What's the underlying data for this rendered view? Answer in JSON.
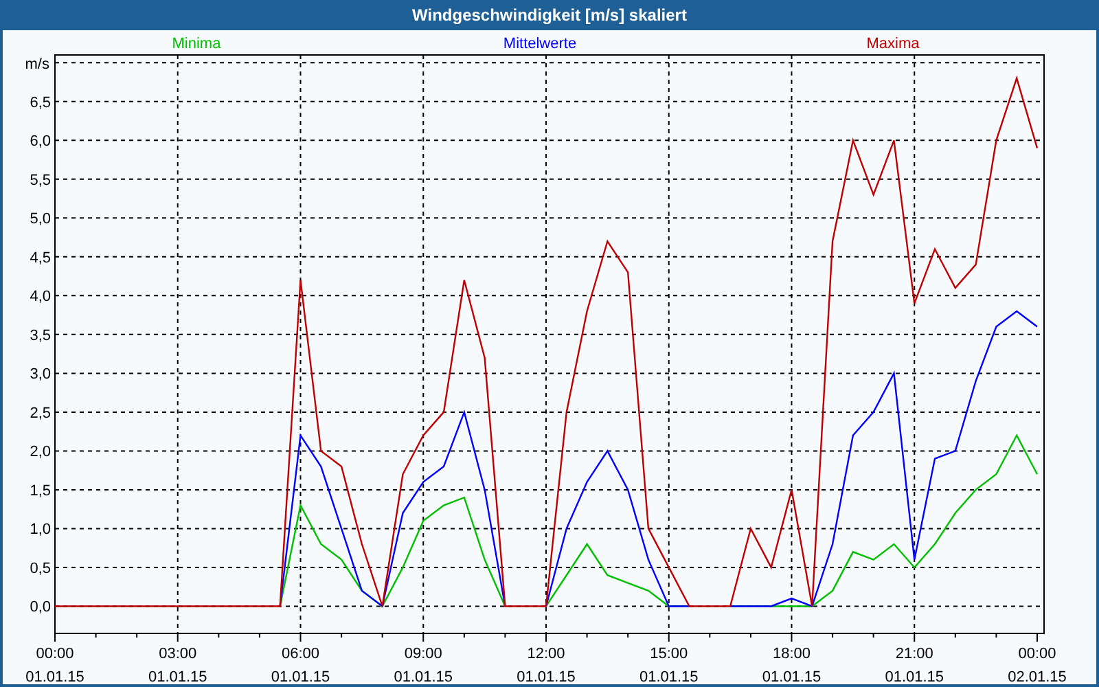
{
  "chart_data": {
    "type": "line",
    "title": "Windgeschwindigkeit [m/s] skaliert",
    "ylabel": "m/s",
    "categories": [
      "00:00\n01.01.15",
      null,
      null,
      null,
      null,
      null,
      "03:00\n01.01.15",
      null,
      null,
      null,
      null,
      null,
      "06:00\n01.01.15",
      null,
      null,
      null,
      null,
      null,
      "09:00\n01.01.15",
      null,
      null,
      null,
      null,
      null,
      "12:00\n01.01.15",
      null,
      null,
      null,
      null,
      null,
      "15:00\n01.01.15",
      null,
      null,
      null,
      null,
      null,
      "18:00\n01.01.15",
      null,
      null,
      null,
      null,
      null,
      "21:00\n01.01.15",
      null,
      null,
      null,
      null,
      null,
      "00:00\n02.01.15"
    ],
    "series": [
      {
        "name": "Minima",
        "color": "#00c000",
        "values": [
          null,
          null,
          null,
          null,
          null,
          null,
          null,
          null,
          null,
          null,
          null,
          0,
          1.3,
          0.8,
          0.6,
          0.2,
          0,
          0.5,
          1.1,
          1.3,
          1.4,
          0.6,
          0,
          null,
          0,
          0.4,
          0.8,
          0.4,
          0.3,
          0.2,
          0,
          0,
          null,
          0,
          0,
          0,
          0,
          0,
          0.2,
          0.7,
          0.6,
          0.8,
          0.5,
          0.8,
          1.2,
          1.5,
          1.7,
          2.2,
          1.7
        ]
      },
      {
        "name": "Mittelwerte",
        "color": "#0000ff",
        "values": [
          null,
          null,
          null,
          null,
          null,
          null,
          null,
          null,
          null,
          null,
          null,
          0,
          2.2,
          1.8,
          1.0,
          0.2,
          0,
          1.2,
          1.6,
          1.8,
          2.5,
          1.5,
          0,
          null,
          0,
          1.0,
          1.6,
          2.0,
          1.5,
          0.6,
          0,
          0,
          null,
          0,
          0,
          0,
          0.1,
          0,
          0.8,
          2.2,
          2.5,
          3.0,
          0.6,
          1.9,
          2.0,
          2.9,
          3.6,
          3.8,
          3.6
        ]
      },
      {
        "name": "Maxima",
        "color": "#c00000",
        "values": [
          0,
          0,
          0,
          0,
          0,
          0,
          0,
          0,
          0,
          0,
          0,
          0,
          4.2,
          2.0,
          1.8,
          0.8,
          0,
          1.7,
          2.2,
          2.5,
          4.2,
          3.2,
          0,
          0,
          0,
          2.5,
          3.8,
          4.7,
          4.3,
          1.0,
          0.5,
          0,
          0,
          0,
          1.0,
          0.5,
          1.5,
          0,
          4.7,
          6.0,
          5.3,
          6.0,
          3.9,
          4.6,
          4.1,
          4.4,
          6.0,
          6.8,
          5.9
        ]
      }
    ],
    "ylim": [
      -0.35,
      7.1
    ],
    "grid": true,
    "yticks": [
      {
        "value": 0,
        "label": "0,0"
      },
      {
        "value": 0.5,
        "label": "0,5"
      },
      {
        "value": 1,
        "label": "1,0"
      },
      {
        "value": 1.5,
        "label": "1,5"
      },
      {
        "value": 2,
        "label": "2,0"
      },
      {
        "value": 2.5,
        "label": "2,5"
      },
      {
        "value": 3,
        "label": "3,0"
      },
      {
        "value": 3.5,
        "label": "3,5"
      },
      {
        "value": 4,
        "label": "4,0"
      },
      {
        "value": 4.5,
        "label": "4,5"
      },
      {
        "value": 5,
        "label": "5,0"
      },
      {
        "value": 5.5,
        "label": "5,5"
      },
      {
        "value": 6,
        "label": "6,0"
      },
      {
        "value": 6.5,
        "label": "6,5"
      }
    ]
  }
}
